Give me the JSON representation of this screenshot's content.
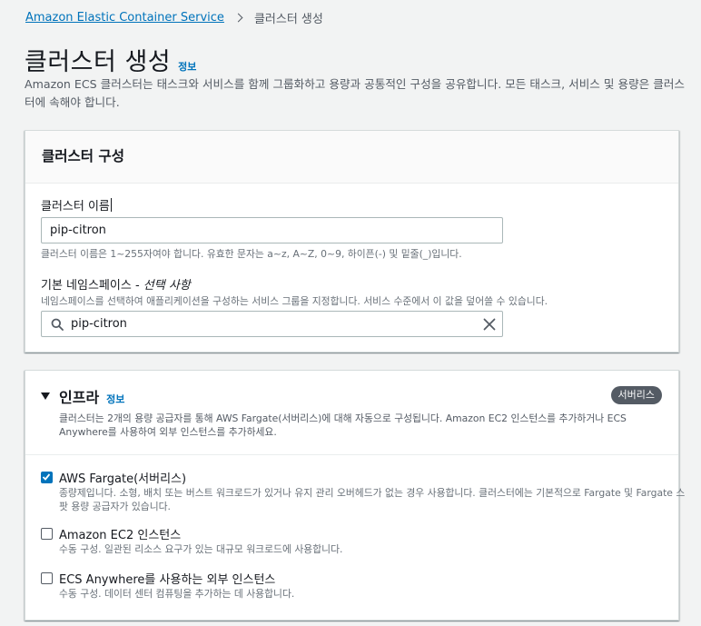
{
  "breadcrumb": {
    "root": "Amazon Elastic Container Service",
    "current": "클러스터 생성"
  },
  "page": {
    "title": "클러스터 생성",
    "info": "정보",
    "description": "Amazon ECS 클러스터는 태스크와 서비스를 함께 그룹화하고 용량과 공통적인 구성을 공유합니다. 모든 태스크, 서비스 및 용량은 클러스터에 속해야 합니다."
  },
  "cluster_config": {
    "heading": "클러스터 구성",
    "name_label": "클러스터 이름",
    "name_value": "pip-citron",
    "name_hint": "클러스터 이름은 1~255자여야 합니다. 유효한 문자는 a~z, A~Z, 0~9, 하이픈(-) 및 밑줄(_)입니다.",
    "namespace_label": "기본 네임스페이스 - ",
    "namespace_optional": "선택 사항",
    "namespace_hint": "네임스페이스를 선택하여 애플리케이션을 구성하는 서비스 그룹을 지정합니다. 서비스 수준에서 이 값을 덮어쓸 수 있습니다.",
    "namespace_value": "pip-citron"
  },
  "infrastructure": {
    "heading": "인프라",
    "info": "정보",
    "badge": "서버리스",
    "description": "클러스터는 2개의 용량 공급자를 통해 AWS Fargate(서버리스)에 대해 자동으로 구성됩니다. Amazon EC2 인스턴스를 추가하거나 ECS Anywhere를 사용하여 외부 인스턴스를 추가하세요.",
    "options": [
      {
        "label": "AWS Fargate(서버리스)",
        "checked": true,
        "description": "종량제입니다. 소형, 배치 또는 버스트 워크로드가 있거나 유지 관리 오버헤드가 없는 경우 사용합니다. 클러스터에는 기본적으로 Fargate 및 Fargate 스팟 용량 공급자가 있습니다."
      },
      {
        "label": "Amazon EC2 인스턴스",
        "checked": false,
        "description": "수동 구성. 일관된 리소스 요구가 있는 대규모 워크로드에 사용합니다."
      },
      {
        "label": "ECS Anywhere를 사용하는 외부 인스턴스",
        "checked": false,
        "description": "수동 구성. 데이터 센터 컴퓨팅을 추가하는 데 사용합니다."
      }
    ]
  },
  "colors": {
    "link": "#0073bb",
    "badge": "#545b64",
    "background": "#f2f3f3"
  }
}
